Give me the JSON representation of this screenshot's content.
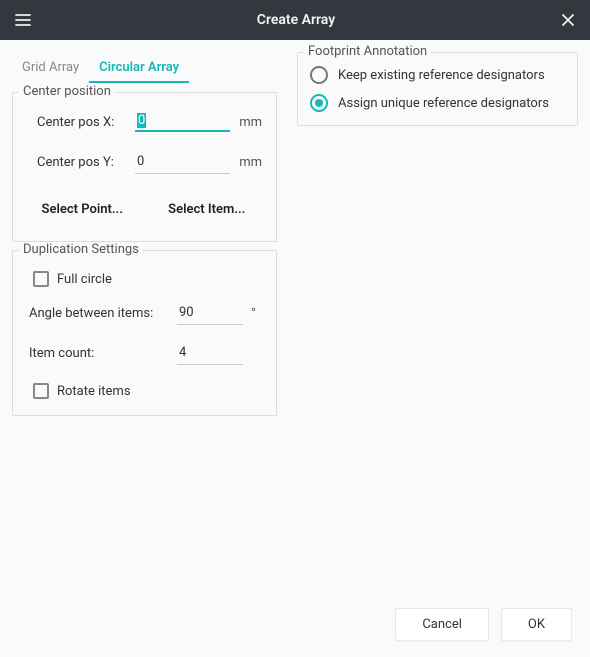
{
  "window": {
    "title": "Create Array"
  },
  "tabs": {
    "grid": "Grid Array",
    "circular": "Circular Array",
    "active": "circular"
  },
  "center": {
    "legend": "Center position",
    "x_label": "Center pos X:",
    "x_value": "0",
    "x_unit": "mm",
    "y_label": "Center pos Y:",
    "y_value": "0",
    "y_unit": "mm",
    "select_point": "Select Point...",
    "select_item": "Select Item..."
  },
  "dup": {
    "legend": "Duplication Settings",
    "full_circle": "Full circle",
    "angle_label": "Angle between items:",
    "angle_value": "90",
    "angle_unit": "°",
    "count_label": "Item count:",
    "count_value": "4",
    "rotate_items": "Rotate items"
  },
  "annotation": {
    "legend": "Footprint Annotation",
    "keep": "Keep existing reference designators",
    "assign": "Assign unique reference designators",
    "selected": "assign"
  },
  "footer": {
    "cancel": "Cancel",
    "ok": "OK"
  }
}
